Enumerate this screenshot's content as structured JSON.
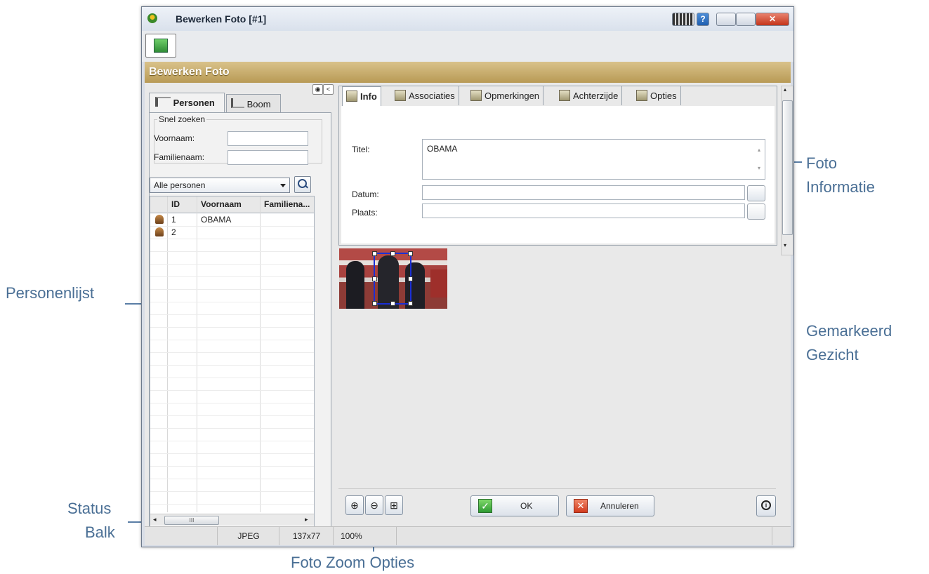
{
  "annotations": {
    "personenlijst": "Personenlijst",
    "status_balk_1": "Status",
    "status_balk_2": "Balk",
    "foto_informatie_1": "Foto",
    "foto_informatie_2": "Informatie",
    "gemarkeerd_gezicht_1": "Gemarkeerd",
    "gemarkeerd_gezicht_2": "Gezicht",
    "foto_zoom_opties": "Foto Zoom Opties"
  },
  "window": {
    "title": "Bewerken Foto [#1]",
    "header": "Bewerken Foto"
  },
  "left": {
    "tabs": [
      "Personen",
      "Boom"
    ],
    "quick_search_legend": "Snel zoeken",
    "voornaam_label": "Voornaam:",
    "familienaam_label": "Familienaam:",
    "filter_selected": "Alle personen",
    "columns": [
      "ID",
      "Voornaam",
      "Familiena..."
    ],
    "rows": [
      {
        "id": "1",
        "voornaam": "OBAMA",
        "familienaam": ""
      },
      {
        "id": "2",
        "voornaam": "",
        "familienaam": ""
      }
    ],
    "scroll_grip": "III"
  },
  "right": {
    "tabs": [
      "Info",
      "Associaties",
      "Opmerkingen",
      "Achterzijde",
      "Opties"
    ],
    "titel_label": "Titel:",
    "titel_value": "OBAMA",
    "datum_label": "Datum:",
    "plaats_label": "Plaats:"
  },
  "buttons": {
    "ok": "OK",
    "annuleren": "Annuleren"
  },
  "status": {
    "format": "JPEG",
    "size": "137x77",
    "zoom": "100%"
  },
  "colors": {
    "accent": "#b89a55",
    "annotation": "#4a6f95"
  }
}
